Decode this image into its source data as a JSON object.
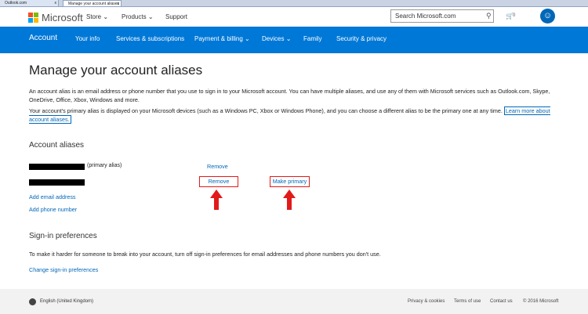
{
  "browser": {
    "tabs": [
      {
        "label": "Outlook.com",
        "close": "x"
      },
      {
        "label": "Manage your account aliases",
        "close": "x"
      }
    ]
  },
  "header": {
    "brand": "Microsoft",
    "nav": [
      "Store",
      "Products",
      "Support"
    ],
    "search_placeholder": "Search Microsoft.com",
    "cart_count": "0",
    "icons": [
      "search-icon",
      "cart-icon",
      "avatar-icon"
    ]
  },
  "account_nav": {
    "items": [
      "Account",
      "Your info",
      "Services & subscriptions",
      "Payment & billing",
      "Devices",
      "Family",
      "Security & privacy"
    ],
    "accent": "#0078d7"
  },
  "main": {
    "title": "Manage your account aliases",
    "para1": "An account alias is an email address or phone number that you use to sign in to your Microsoft account. You can have multiple aliases, and use any of them with Microsoft services such as Outlook.com, Skype, OneDrive, Office, Xbox, Windows and more.",
    "para2": "Your account's primary alias is displayed on your Microsoft devices (such as a Windows PC, Xbox or Windows Phone), and you can choose a different alias to be the primary one at any time.",
    "learn_more": "Learn more about account aliases.",
    "aliases_heading": "Account aliases",
    "primary_tag": "(primary alias)",
    "remove": "Remove",
    "make_primary": "Make primary",
    "add_email": "Add email address",
    "add_phone": "Add phone number",
    "signin_heading": "Sign-in preferences",
    "signin_para": "To make it harder for someone to break into your account, turn off sign-in preferences for email addresses and phone numbers you don't use.",
    "change_signin": "Change sign-in preferences"
  },
  "footer": {
    "locale": "English (United Kingdom)",
    "links": [
      "Privacy & cookies",
      "Terms of use",
      "Contact us",
      "© 2016 Microsoft"
    ]
  },
  "colors": {
    "link": "#0067b8",
    "annotation": "#e21a1a"
  }
}
